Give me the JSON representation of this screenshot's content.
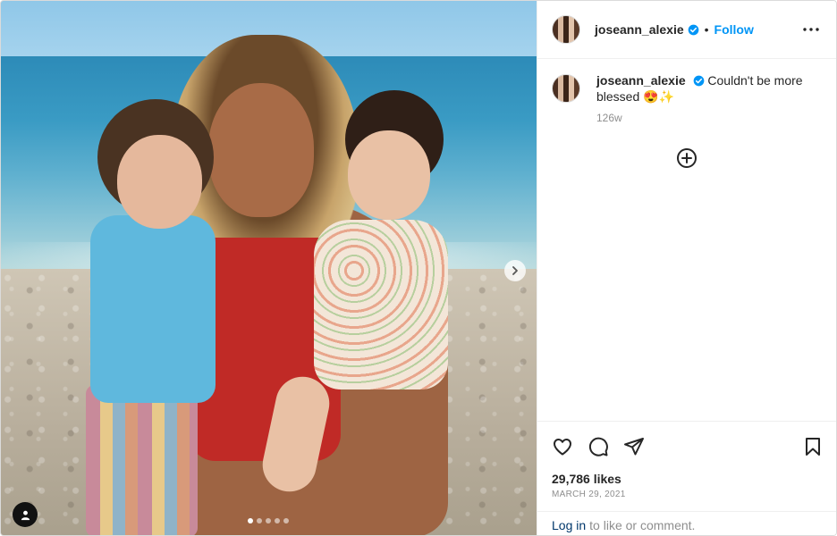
{
  "post": {
    "username": "joseann_alexie",
    "separator": "•",
    "follow_label": "Follow",
    "caption_text": "Couldn't be more blessed 😍✨",
    "time_ago": "126w",
    "likes": "29,786 likes",
    "date": "MARCH 29, 2021",
    "login_link": "Log in",
    "login_suffix": "to like or comment."
  },
  "carousel": {
    "current": 1,
    "total": 5
  },
  "colors": {
    "accent": "#0095f6",
    "text": "#262626",
    "muted": "#8e8e8e",
    "link": "#00376b"
  },
  "icons": [
    "verified-badge-icon",
    "more-options-icon",
    "add-comment-icon",
    "heart-icon",
    "comment-icon",
    "share-icon",
    "bookmark-icon",
    "chevron-right-icon",
    "user-tag-icon"
  ]
}
